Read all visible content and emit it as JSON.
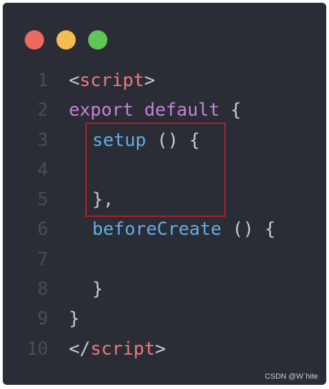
{
  "window": {
    "traffic_lights": [
      {
        "name": "close",
        "color": "#ee6a5e"
      },
      {
        "name": "minimize",
        "color": "#f5bd4f"
      },
      {
        "name": "maximize",
        "color": "#61c554"
      }
    ],
    "background": "#2b2d36"
  },
  "colors": {
    "punct": "#c9cbd2",
    "tag": "#ef7a7a",
    "keyword": "#c682d9",
    "func": "#61aee8",
    "line_number": "#4a4d58",
    "highlight_border": "#b81d22"
  },
  "code": {
    "lines": [
      {
        "num": "1",
        "indent": 0,
        "tokens": [
          {
            "t": "<",
            "c": "punct"
          },
          {
            "t": "script",
            "c": "tag"
          },
          {
            "t": ">",
            "c": "punct"
          }
        ]
      },
      {
        "num": "2",
        "indent": 0,
        "tokens": [
          {
            "t": "export default ",
            "c": "keyword"
          },
          {
            "t": "{",
            "c": "punct"
          }
        ]
      },
      {
        "num": "3",
        "indent": 1,
        "tokens": [
          {
            "t": "setup",
            "c": "func"
          },
          {
            "t": " () {",
            "c": "punct"
          }
        ]
      },
      {
        "num": "4",
        "indent": 1,
        "tokens": []
      },
      {
        "num": "5",
        "indent": 1,
        "tokens": [
          {
            "t": "},",
            "c": "punct"
          }
        ]
      },
      {
        "num": "6",
        "indent": 1,
        "tokens": [
          {
            "t": "beforeCreate",
            "c": "func"
          },
          {
            "t": " () {",
            "c": "punct"
          }
        ]
      },
      {
        "num": "7",
        "indent": 1,
        "tokens": []
      },
      {
        "num": "8",
        "indent": 1,
        "tokens": [
          {
            "t": "}",
            "c": "punct"
          }
        ]
      },
      {
        "num": "9",
        "indent": 0,
        "tokens": [
          {
            "t": "}",
            "c": "punct"
          }
        ]
      },
      {
        "num": "10",
        "indent": 0,
        "tokens": [
          {
            "t": "</",
            "c": "punct"
          },
          {
            "t": "script",
            "c": "tag"
          },
          {
            "t": ">",
            "c": "punct"
          }
        ]
      }
    ]
  },
  "watermark": "CSDN @W`hite"
}
